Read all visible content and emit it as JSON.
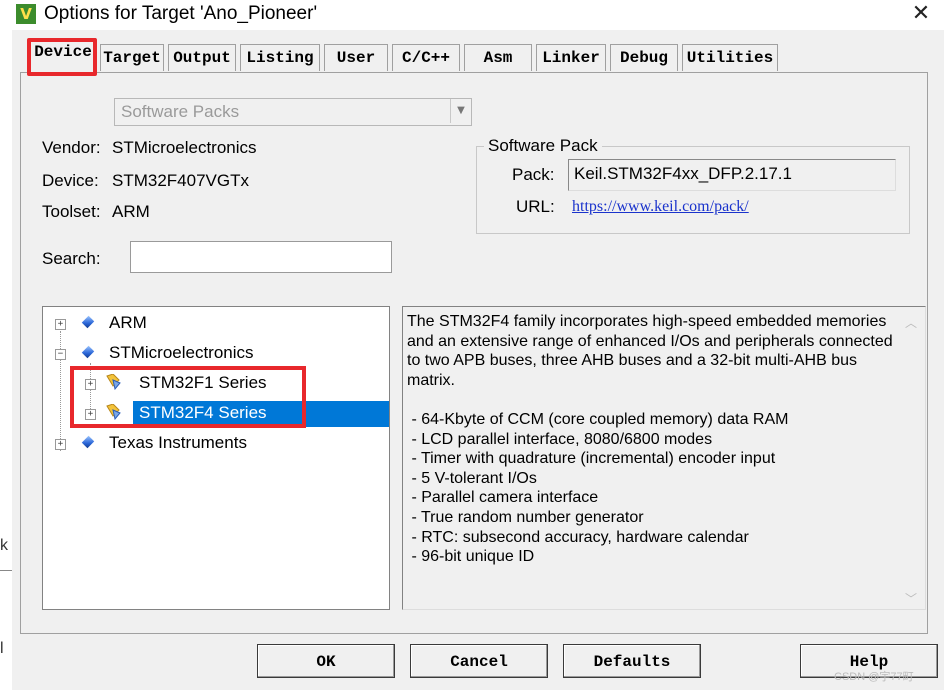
{
  "window": {
    "title": "Options for Target 'Ano_Pioneer'",
    "app_icon_letter": "V",
    "close_icon": "close-icon"
  },
  "tabs": [
    {
      "label": "Device",
      "active": true
    },
    {
      "label": "Target"
    },
    {
      "label": "Output"
    },
    {
      "label": "Listing"
    },
    {
      "label": "User"
    },
    {
      "label": "C/C++"
    },
    {
      "label": "Asm"
    },
    {
      "label": "Linker"
    },
    {
      "label": "Debug"
    },
    {
      "label": "Utilities"
    }
  ],
  "database": {
    "selected": "Software Packs"
  },
  "device_info": {
    "vendor_label": "Vendor:",
    "vendor": "STMicroelectronics",
    "device_label": "Device:",
    "device": "STM32F407VGTx",
    "toolset_label": "Toolset:",
    "toolset": "ARM"
  },
  "software_pack": {
    "group_title": "Software Pack",
    "pack_label": "Pack:",
    "pack": "Keil.STM32F4xx_DFP.2.17.1",
    "url_label": "URL:",
    "url": "https://www.keil.com/pack/"
  },
  "search": {
    "label": "Search:",
    "value": ""
  },
  "tree": [
    {
      "label": "ARM",
      "expander": "+",
      "icon": "vendor-gem-icon"
    },
    {
      "label": "STMicroelectronics",
      "expander": "−",
      "icon": "vendor-gem-icon"
    },
    {
      "label": "STM32F1 Series",
      "expander": "+",
      "icon": "device-family-icon"
    },
    {
      "label": "STM32F4 Series",
      "expander": "+",
      "icon": "device-family-icon",
      "selected": true
    },
    {
      "label": "Texas Instruments",
      "expander": "+",
      "icon": "vendor-gem-icon"
    }
  ],
  "description": {
    "text": "The STM32F4 family incorporates high-speed embedded memories\nand an extensive range of enhanced I/Os and peripherals connected\nto two APB buses, three AHB buses and a 32-bit multi-AHB bus\nmatrix.\n\n - 64-Kbyte of CCM (core coupled memory) data RAM\n - LCD parallel interface, 8080/6800 modes\n - Timer with quadrature (incremental) encoder input\n - 5 V-tolerant I/Os\n - Parallel camera interface\n - True random number generator\n - RTC: subsecond accuracy, hardware calendar\n - 96-bit unique ID"
  },
  "buttons": {
    "ok": "OK",
    "cancel": "Cancel",
    "defaults": "Defaults",
    "help": "Help"
  },
  "watermark": "CSDN @宇77町",
  "backdrop": {
    "char_a": "k",
    "char_b": "l"
  },
  "colors": {
    "selection": "#0078d7",
    "annotation_red": "#e8282c",
    "link": "#1a33cc"
  }
}
